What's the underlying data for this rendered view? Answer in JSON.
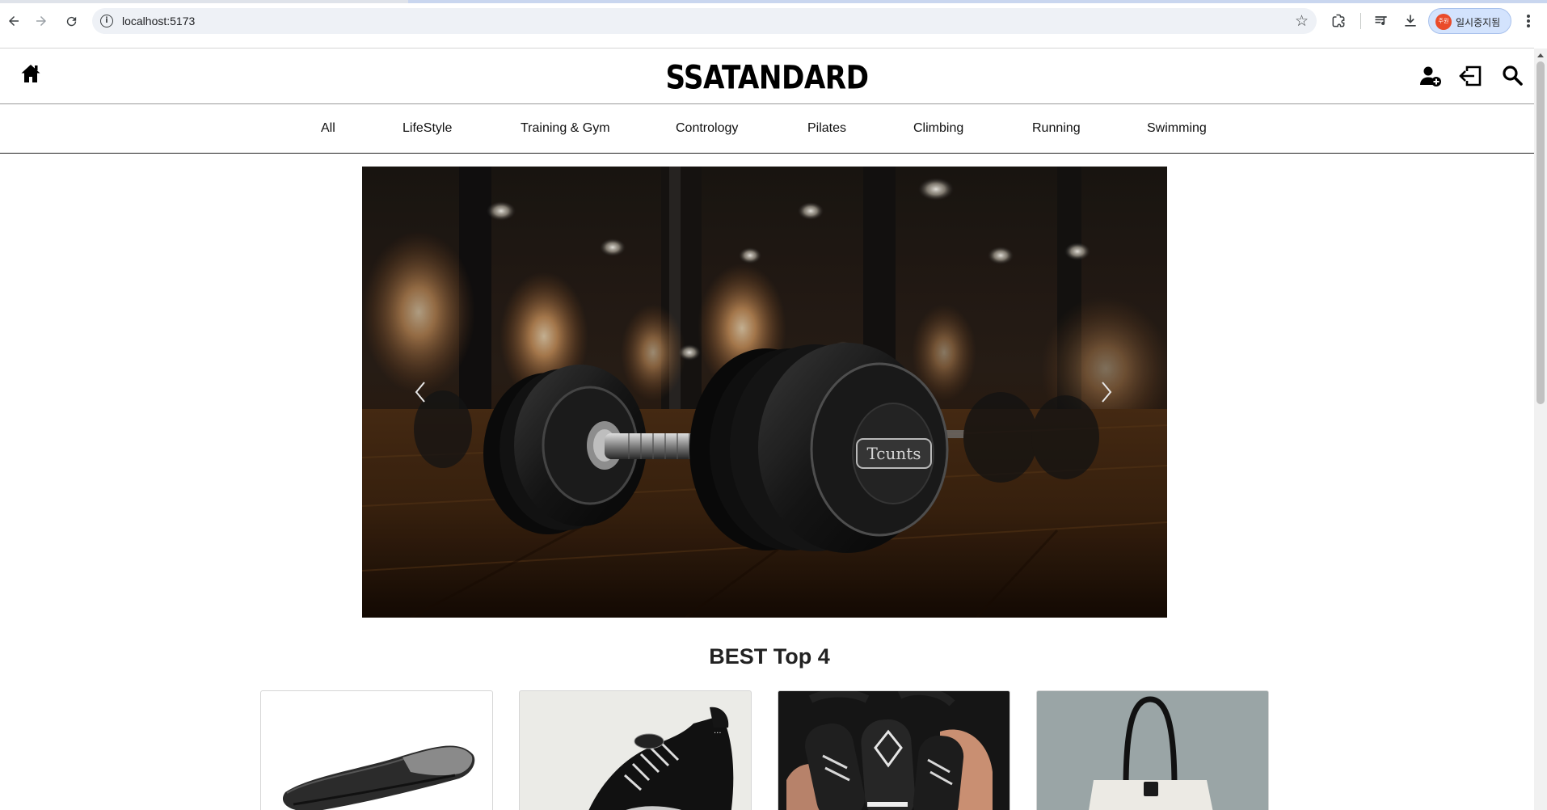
{
  "browser": {
    "url": "localhost:5173",
    "profile_badge": "주원",
    "profile_label": "일시중지됨",
    "icons": [
      "back-arrow-icon",
      "forward-arrow-icon",
      "reload-icon",
      "site-info-icon",
      "bookmark-star-icon",
      "extensions-icon",
      "media-control-icon",
      "download-icon",
      "more-menu-icon"
    ]
  },
  "header": {
    "logo": "SSATANDARD",
    "icons": [
      "home-icon",
      "user-plus-icon",
      "logout-icon",
      "search-icon"
    ]
  },
  "categories": [
    "All",
    "LifeStyle",
    "Training & Gym",
    "Contrology",
    "Pilates",
    "Climbing",
    "Running",
    "Swimming"
  ],
  "carousel": {
    "current_image": "dumbbell-gym-floor",
    "dumbbell_text": "Tcunts",
    "prev_icon": "chevron-left-icon",
    "next_icon": "chevron-right-icon"
  },
  "best": {
    "title": "BEST Top 4",
    "products": [
      {
        "image": "shoe-insole"
      },
      {
        "image": "black-sneaker"
      },
      {
        "image": "jump-rope-handles"
      },
      {
        "image": "canvas-tote-bag"
      }
    ]
  },
  "colors": {
    "page_bg": "#ffffff",
    "text": "#111111",
    "header_rule": "#222222",
    "profile_badge": "#ea4b2a"
  }
}
